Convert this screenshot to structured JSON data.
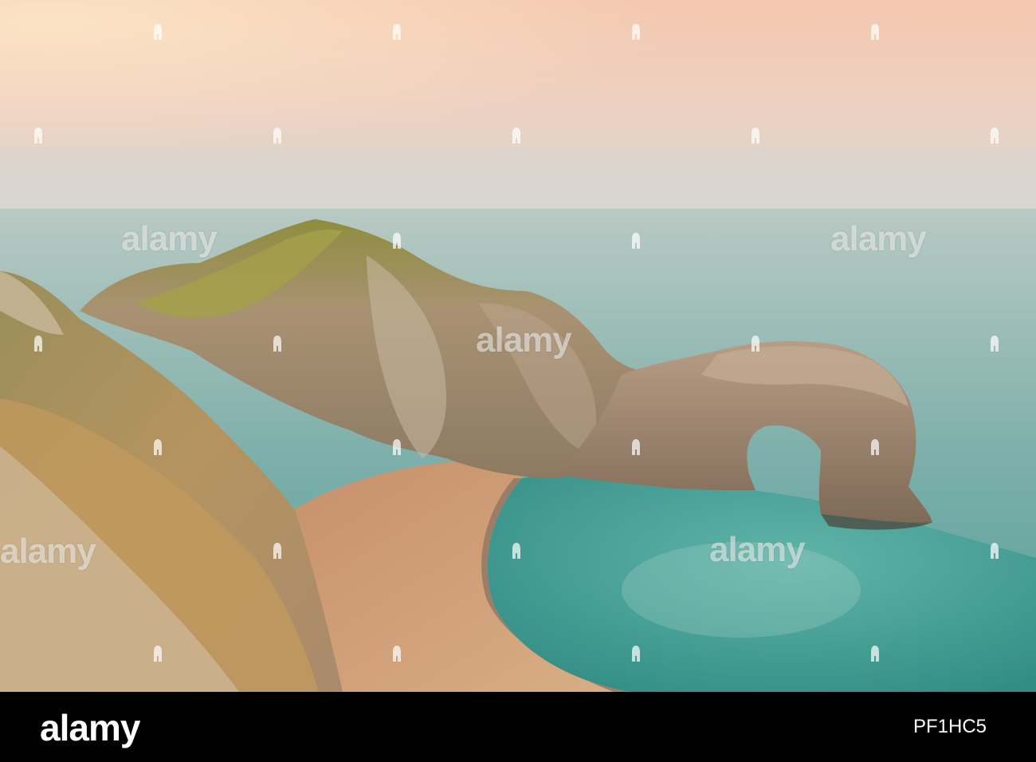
{
  "photo": {
    "scene": "sea arch at sunset",
    "colors": {
      "sky_top": "#f3cdb4",
      "sky_bottom": "#dcd6cf",
      "sea": "#8fb8b3",
      "lagoon": "#3f9c92",
      "beach": "#cfa57e",
      "rock": "#a98a6c",
      "grass": "#8c8a3a"
    }
  },
  "watermark": {
    "text": "alamy",
    "mark_icon": "alamy-a-mark-icon"
  },
  "footer": {
    "logo": "alamy",
    "image_id": "PF1HC5"
  }
}
